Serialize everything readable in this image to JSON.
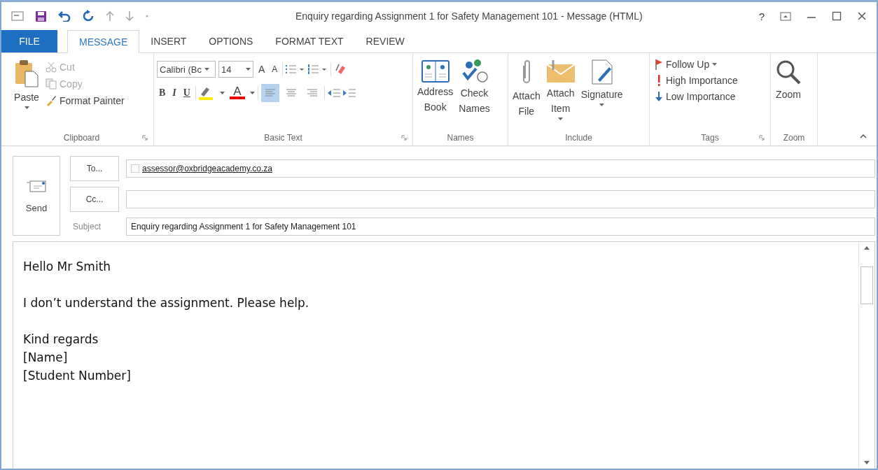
{
  "window": {
    "title": "Enquiry regarding Assignment 1 for Safety Management 101 - Message (HTML)",
    "help": "?"
  },
  "tabs": [
    {
      "label": "FILE",
      "kind": "file",
      "selected": false
    },
    {
      "label": "MESSAGE",
      "kind": "tab",
      "selected": true
    },
    {
      "label": "INSERT",
      "kind": "tab",
      "selected": false
    },
    {
      "label": "OPTIONS",
      "kind": "tab",
      "selected": false
    },
    {
      "label": "FORMAT TEXT",
      "kind": "tab",
      "selected": false
    },
    {
      "label": "REVIEW",
      "kind": "tab",
      "selected": false
    }
  ],
  "ribbon": {
    "clipboard": {
      "label": "Clipboard",
      "paste": "Paste",
      "cut": "Cut",
      "copy": "Copy",
      "format_painter": "Format Painter"
    },
    "basic_text": {
      "label": "Basic Text",
      "font": "Calibri (Bc",
      "size": "14",
      "grow": "A",
      "shrink": "A",
      "bold": "B",
      "italic": "I",
      "underline": "U",
      "font_color": "A",
      "alignments": [
        {
          "selected": true
        },
        {
          "selected": false
        },
        {
          "selected": false
        }
      ]
    },
    "names": {
      "label": "Names",
      "address_book": "Address Book",
      "check_names": "Check Names"
    },
    "include": {
      "label": "Include",
      "attach_file": "Attach File",
      "attach_item": "Attach Item",
      "signature": "Signature"
    },
    "tags": {
      "label": "Tags",
      "follow_up": "Follow Up",
      "high": "High Importance",
      "low": "Low Importance"
    },
    "zoom": {
      "label": "Zoom",
      "button": "Zoom"
    }
  },
  "compose": {
    "send": "Send",
    "to_button": "To...",
    "cc_button": "Cc...",
    "subject_label": "Subject",
    "to": "assessor@oxbridgeacademy.co.za",
    "subject": "Enquiry regarding Assignment 1 for Safety Management 101"
  },
  "body": [
    [
      "Hello Mr Smith"
    ],
    [
      "I don’t understand the assignment. Please help."
    ],
    [
      "Kind regards",
      "[Name]",
      "[Student Number]"
    ]
  ]
}
